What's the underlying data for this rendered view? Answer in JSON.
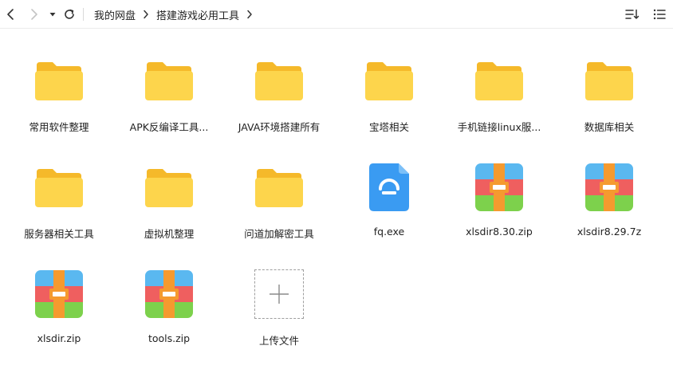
{
  "breadcrumb": {
    "items": [
      "我的网盘",
      "搭建游戏必用工具"
    ]
  },
  "toolbar": {
    "back_icon": "chevron-left-icon",
    "forward_icon": "chevron-right-icon",
    "history_icon": "caret-down-icon",
    "refresh_icon": "refresh-icon",
    "sort_icon": "sort-icon",
    "view_icon": "list-view-icon"
  },
  "files": [
    {
      "name": "常用软件整理",
      "type": "folder"
    },
    {
      "name": "APK反编译工具...",
      "type": "folder"
    },
    {
      "name": "JAVA环境搭建所有",
      "type": "folder"
    },
    {
      "name": "宝塔相关",
      "type": "folder"
    },
    {
      "name": "手机链接linux服...",
      "type": "folder"
    },
    {
      "name": "数据库相关",
      "type": "folder"
    },
    {
      "name": "服务器相关工具",
      "type": "folder"
    },
    {
      "name": "虚拟机整理",
      "type": "folder"
    },
    {
      "name": "问道加解密工具",
      "type": "folder"
    },
    {
      "name": "fq.exe",
      "type": "exe"
    },
    {
      "name": "xlsdir8.30.zip",
      "type": "archive"
    },
    {
      "name": "xlsdir8.29.7z",
      "type": "archive"
    },
    {
      "name": "xlsdir.zip",
      "type": "archive"
    },
    {
      "name": "tools.zip",
      "type": "archive"
    }
  ],
  "upload": {
    "label": "上传文件"
  },
  "colors": {
    "folder_back": "#F5B92A",
    "folder_front": "#FDD54C",
    "exe_blue": "#3A9BF2",
    "archive_top": "#5AB8F0",
    "archive_mid": "#EF5F5F",
    "archive_bottom": "#7DD14C",
    "archive_strap": "#F59A2F"
  }
}
